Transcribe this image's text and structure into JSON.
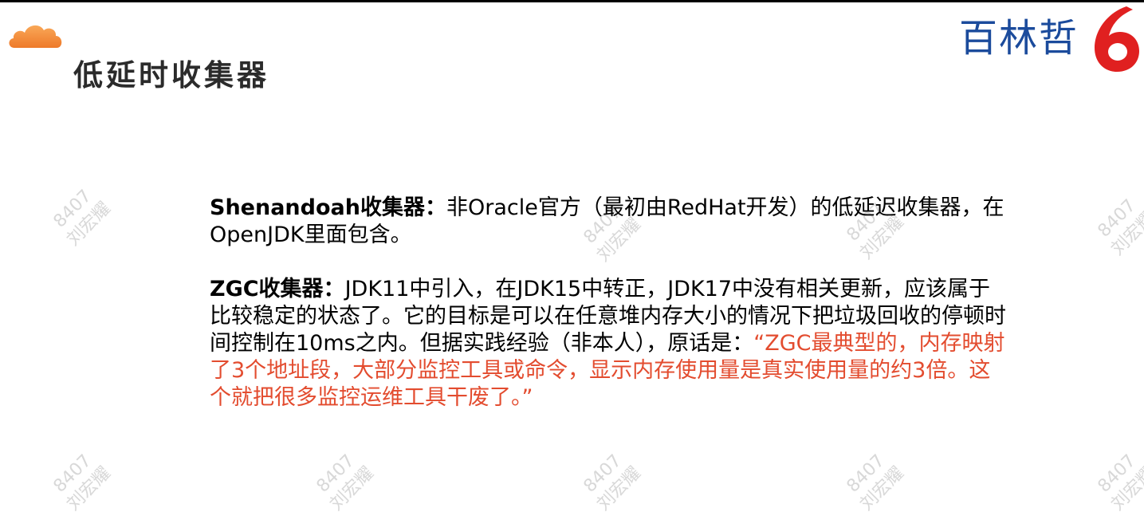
{
  "slide": {
    "title": "低延时收集器"
  },
  "brand": {
    "name": "百林哲",
    "mark": "6"
  },
  "content": {
    "shenandoah": {
      "label": "Shenandoah收集器：",
      "text": "非Oracle官方（最初由RedHat开发）的低延迟收集器，在OpenJDK里面包含。"
    },
    "zgc": {
      "label": "ZGC收集器：",
      "text": "JDK11中引入，在JDK15中转正，JDK17中没有相关更新，应该属于比较稳定的状态了。它的目标是可以在任意堆内存大小的情况下把垃圾回收的停顿时间控制在10ms之内。但据实践经验（非本人），原话是：",
      "quote": "“ZGC最典型的，内存映射了3个地址段，大部分监控工具或命令，显示内存使用量是真实使用量的约3倍。这个就把很多监控运维工具干废了。”"
    }
  },
  "watermark": {
    "lines": [
      "8407",
      "刘宏耀"
    ]
  },
  "colors": {
    "accent": "#e34c2f",
    "brand_blue": "#1b4b9c",
    "brand_red": "#e02020",
    "cloud": "#f08a3a"
  }
}
